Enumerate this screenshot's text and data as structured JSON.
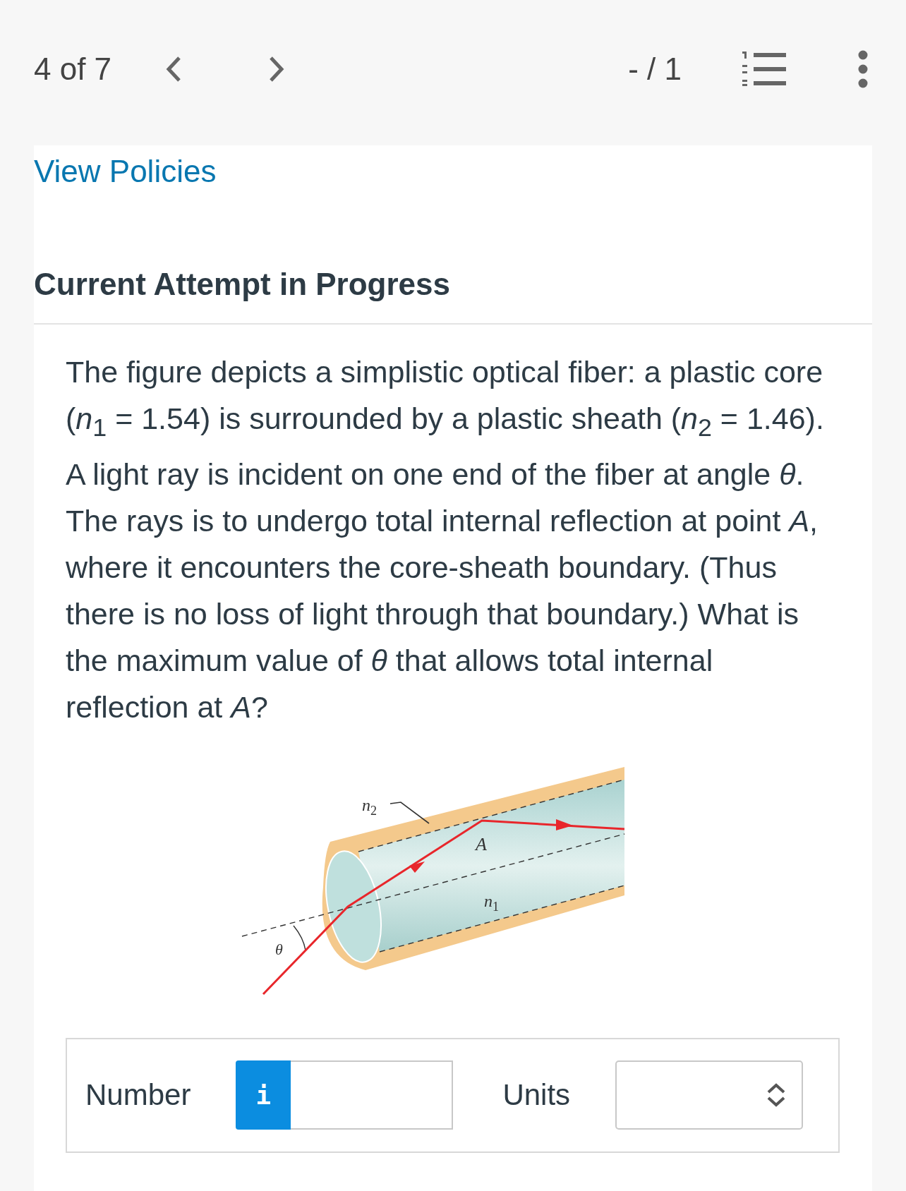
{
  "top_bar": {
    "position": "4 of 7",
    "score": "- / 1"
  },
  "policies_link": "View Policies",
  "attempt_heading": "Current Attempt in Progress",
  "question": "The figure depicts a simplistic optical fiber: a plastic core (*n*$_{1}$ = 1.54) is surrounded by a plastic sheath (*n*$_{2}$ = 1.46). A light ray is incident on one end of the fiber at angle *θ*. The rays is to undergo total internal reflection at point *A*, where it encounters the core-sheath boundary. (Thus there is no loss of light through that boundary.) What is the maximum value of *θ* that allows total internal reflection at *A*?",
  "figure": {
    "labels": [
      {
        "kind": "sheath",
        "text": "n$_{2}$"
      },
      {
        "kind": "point",
        "text": "A"
      },
      {
        "kind": "core",
        "text": "n$_{1}$"
      },
      {
        "kind": "angle",
        "text": "θ"
      }
    ]
  },
  "answer": {
    "number_label": "Number",
    "info_button": "i",
    "units_label": "Units"
  }
}
